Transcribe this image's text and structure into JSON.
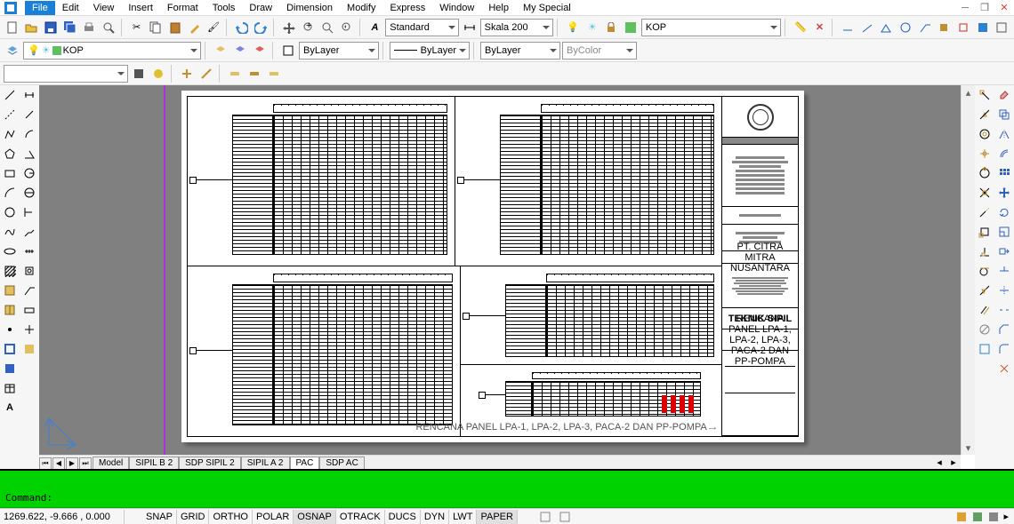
{
  "menu": {
    "items": [
      "File",
      "Edit",
      "View",
      "Insert",
      "Format",
      "Tools",
      "Draw",
      "Dimension",
      "Modify",
      "Express",
      "Window",
      "Help",
      "My Special"
    ]
  },
  "toolbar1": {
    "text_style": "Standard",
    "dim_style": "Skala 200",
    "layer": "KOP",
    "layer2": "KOP"
  },
  "toolbar2": {
    "linetype": "ByLayer",
    "lineweight": "ByLayer",
    "plotstyle": "ByLayer",
    "color": "ByColor"
  },
  "tabs": {
    "nav": [
      "⏮",
      "◀",
      "▶",
      "⏭"
    ],
    "items": [
      "Model",
      "SIPIL B 2",
      "SDP SIPIL 2",
      "SIPIL A 2",
      "PAC",
      "SDP AC"
    ],
    "active": 4
  },
  "command": {
    "prompt": "Command:"
  },
  "status": {
    "coords": "1269.622, -9.666 , 0.000",
    "toggles": [
      "SNAP",
      "GRID",
      "ORTHO",
      "POLAR",
      "OSNAP",
      "OTRACK",
      "DUCS",
      "DYN",
      "LWT",
      "PAPER"
    ]
  },
  "drawing": {
    "title_note": "RENCANA PANEL LPA-1, LPA-2, LPA-3, PACA-2 DAN PP-POMPA",
    "company": "PT. CITRA MITRA NUSANTARA",
    "block_label": "TEKNIK SIPIL",
    "sheet_title": "RENCANA PANEL LPA-1, LPA-2, LPA-3, PACA-2 DAN PP-POMPA"
  }
}
